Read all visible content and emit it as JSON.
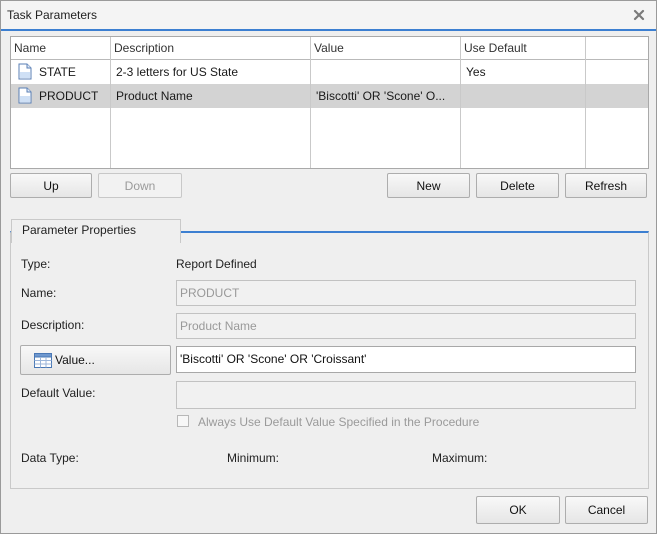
{
  "window": {
    "title": "Task Parameters"
  },
  "table": {
    "columns": [
      "Name",
      "Description",
      "Value",
      "Use Default"
    ],
    "rows": [
      {
        "name": "STATE",
        "description": "2-3 letters for US State",
        "value": "",
        "use_default": "Yes"
      },
      {
        "name": "PRODUCT",
        "description": "Product Name",
        "value": "'Biscotti' OR 'Scone' O...",
        "use_default": ""
      }
    ]
  },
  "list_buttons": {
    "up": "Up",
    "down": "Down",
    "new": "New",
    "delete": "Delete",
    "refresh": "Refresh"
  },
  "properties": {
    "legend": "Parameter Properties",
    "type_label": "Type:",
    "type_value": "Report Defined",
    "name_label": "Name:",
    "name_value": "PRODUCT",
    "description_label": "Description:",
    "description_value": "Product Name",
    "value_button": "Value...",
    "value_value": "'Biscotti' OR 'Scone' OR 'Croissant'",
    "default_label": "Default Value:",
    "default_value": "",
    "checkbox_label": "Always Use Default Value Specified in the Procedure",
    "data_type_label": "Data Type:",
    "minimum_label": "Minimum:",
    "maximum_label": "Maximum:"
  },
  "dialog_buttons": {
    "ok": "OK",
    "cancel": "Cancel"
  },
  "colors": {
    "accent": "#3c7fd1",
    "selected_row": "#d3d3d3"
  }
}
